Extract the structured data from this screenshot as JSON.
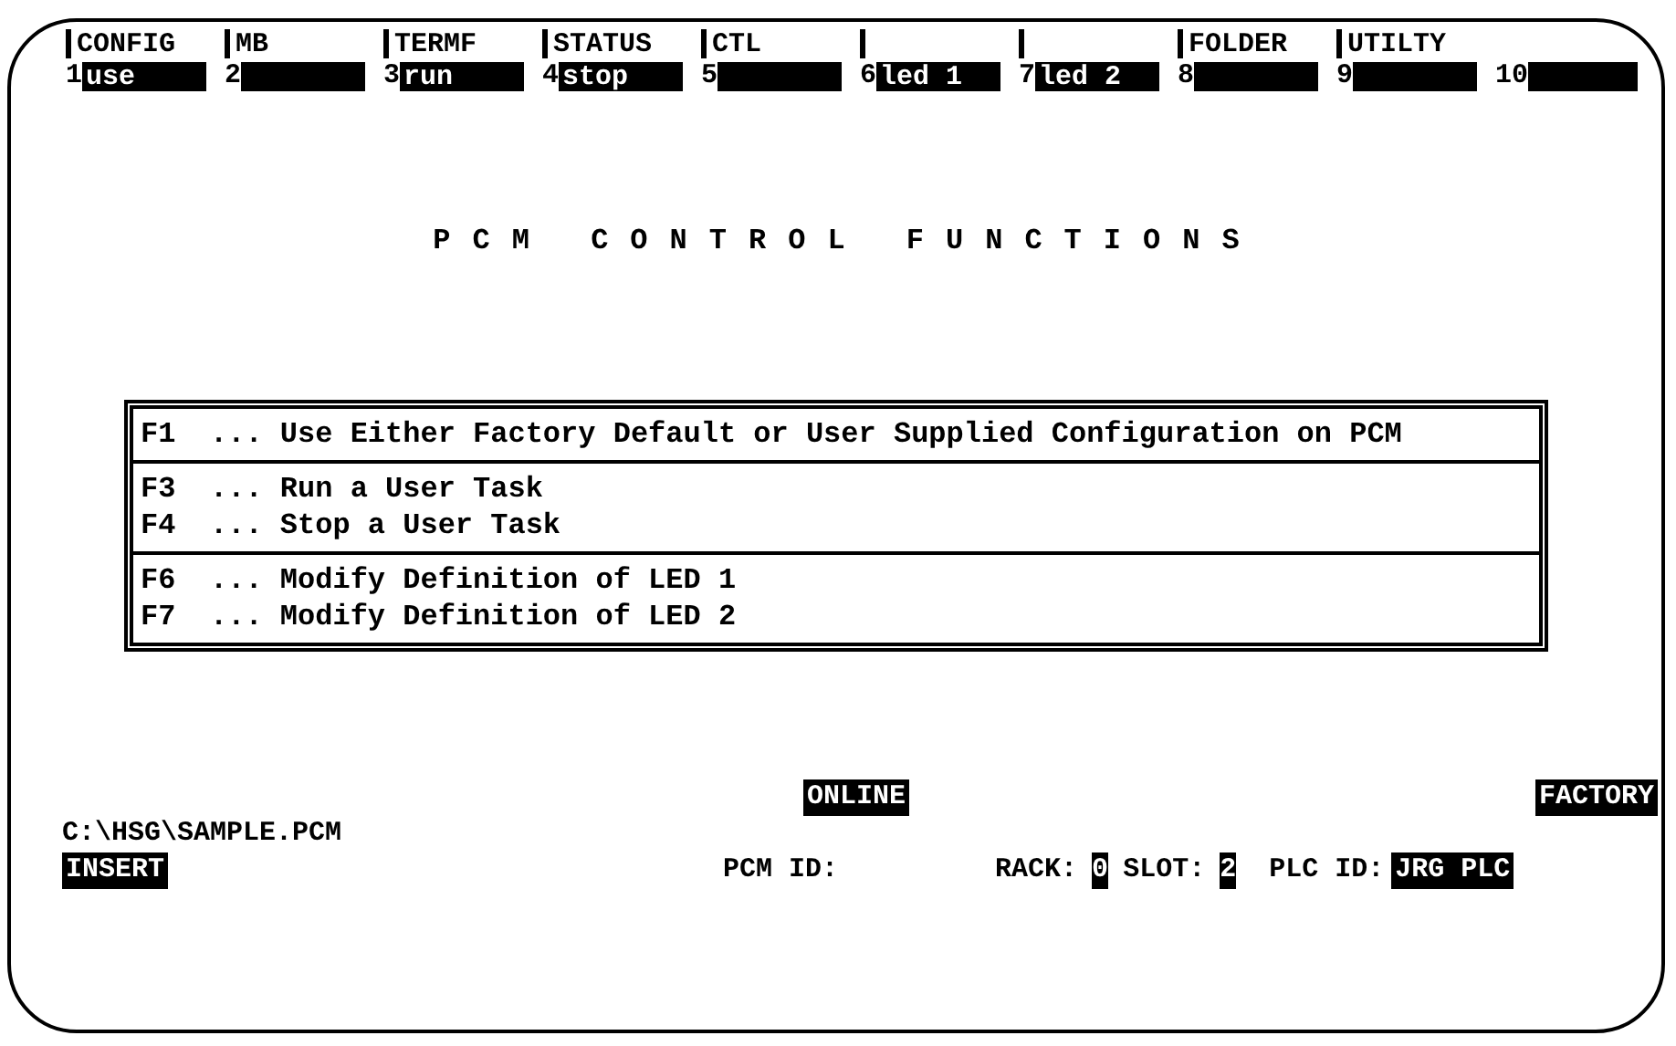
{
  "function_keys": [
    {
      "number": "1",
      "group": "CONFIG",
      "label": "use"
    },
    {
      "number": "2",
      "group": "MB"
    },
    {
      "number": "3",
      "group": "TERMF",
      "label": "run"
    },
    {
      "number": "4",
      "group": "STATUS",
      "label": "stop"
    },
    {
      "number": "5",
      "group": "CTL"
    },
    {
      "number": "6",
      "label": "led 1"
    },
    {
      "number": "7",
      "label": "led 2"
    },
    {
      "number": "8",
      "group": "FOLDER"
    },
    {
      "number": "9",
      "group": "UTILTY"
    },
    {
      "number": "10"
    }
  ],
  "title": "PCM CONTROL FUNCTIONS",
  "menu_groups": [
    [
      {
        "key": "F1",
        "text": "... Use Either Factory Default or User Supplied Configuration on PCM"
      }
    ],
    [
      {
        "key": "F3",
        "text": "... Run a User Task"
      },
      {
        "key": "F4",
        "text": "... Stop a User Task"
      }
    ],
    [
      {
        "key": "F6",
        "text": "... Modify Definition of LED 1"
      },
      {
        "key": "F7",
        "text": "... Modify Definition of LED 2"
      }
    ]
  ],
  "status": {
    "connection": "ONLINE",
    "config_source": "FACTORY",
    "file_path": "C:\\HSG\\SAMPLE.PCM",
    "mode": "INSERT",
    "pcm_id_label": "PCM ID:",
    "rack_label": "RACK:",
    "rack": "0",
    "slot_label": "SLOT:",
    "slot": "2",
    "plc_id_label": "PLC ID:",
    "plc_id": "JRG PLC"
  }
}
